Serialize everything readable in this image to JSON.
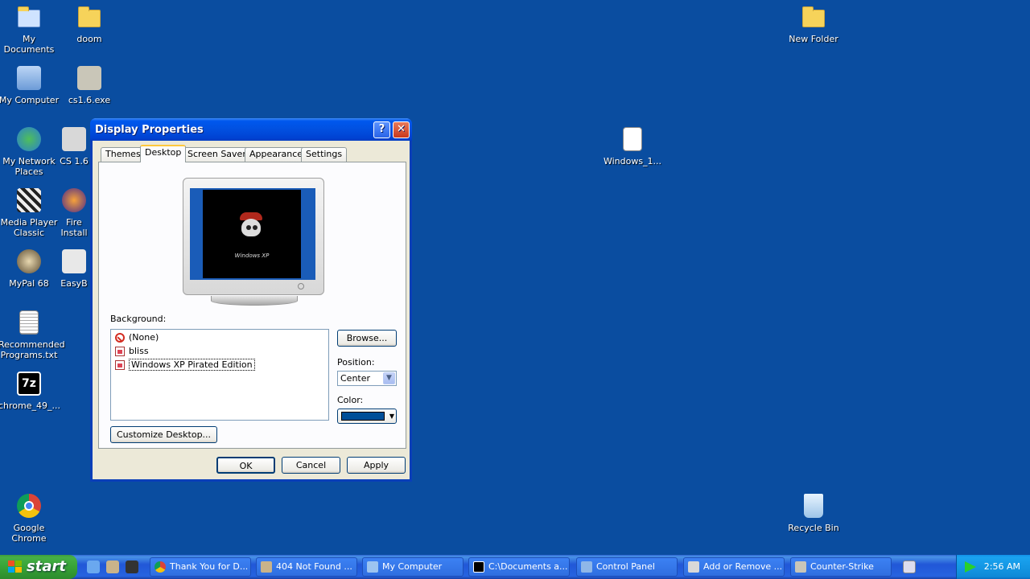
{
  "desktop": {
    "icons": [
      {
        "label": "My Documents"
      },
      {
        "label": "doom"
      },
      {
        "label": "New Folder"
      },
      {
        "label": "My Computer"
      },
      {
        "label": "cs1.6.exe"
      },
      {
        "label": "My Network Places"
      },
      {
        "label": "CS 1.6"
      },
      {
        "label": "Windows_1..."
      },
      {
        "label": "Media Player Classic"
      },
      {
        "label": "Fire Install"
      },
      {
        "label": "MyPal 68"
      },
      {
        "label": "EasyB"
      },
      {
        "label": "Recommended Programs.txt"
      },
      {
        "label": "chrome_49_..."
      },
      {
        "label": "Google Chrome"
      },
      {
        "label": "Recycle Bin"
      }
    ]
  },
  "dialog": {
    "title": "Display Properties",
    "help_btn": "?",
    "close_btn": "✕",
    "tabs": [
      "Themes",
      "Desktop",
      "Screen Saver",
      "Appearance",
      "Settings"
    ],
    "active_tab": "Desktop",
    "preview_brand": "Windows XP",
    "background_label": "Background:",
    "background_items": [
      "(None)",
      "bliss",
      "Windows XP Pirated Edition"
    ],
    "selected_background": "Windows XP Pirated Edition",
    "browse_btn": "Browse...",
    "position_label": "Position:",
    "position_value": "Center",
    "color_label": "Color:",
    "color_value": "#004e98",
    "customize_btn": "Customize Desktop...",
    "ok_btn": "OK",
    "cancel_btn": "Cancel",
    "apply_btn": "Apply"
  },
  "taskbar": {
    "start_label": "start",
    "tasks": [
      {
        "label": "Thank You for D..."
      },
      {
        "label": "404 Not Found ..."
      },
      {
        "label": "My Computer"
      },
      {
        "label": "C:\\Documents a..."
      },
      {
        "label": "Control Panel"
      },
      {
        "label": "Add or Remove ..."
      },
      {
        "label": "Counter-Strike"
      }
    ],
    "clock": "2:56 AM"
  }
}
